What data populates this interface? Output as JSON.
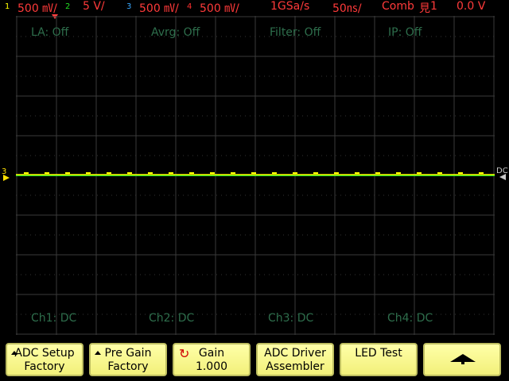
{
  "status": {
    "ch1": {
      "num": "1",
      "scale": "500 ㎷/"
    },
    "ch2": {
      "num": "2",
      "scale": "5 V/"
    },
    "ch3": {
      "num": "3",
      "scale": "500 ㎷/"
    },
    "ch4": {
      "num": "4",
      "scale": "500 ㎷/"
    },
    "sample_rate": "1GSa/s",
    "timebase": "50㎱/",
    "trigger_mode": "Comb",
    "trigger_icon": "rising-edge-icon",
    "trigger_source": "1",
    "trigger_level": "0.0 V"
  },
  "overlay": {
    "la": "LA: Off",
    "avrg": "Avrg: Off",
    "filter": "Filter: Off",
    "ip": "IP: Off",
    "ch1_coupling": "Ch1: DC",
    "ch2_coupling": "Ch2: DC",
    "ch3_coupling": "Ch3: DC",
    "ch4_coupling": "Ch4: DC"
  },
  "markers": {
    "channel_ground": "3",
    "dc_label": "DC"
  },
  "colors": {
    "ch1": "#ffff00",
    "ch2": "#22dd22",
    "ch3": "#3aa8ff",
    "ch4": "#ff3030",
    "grid": "#3a3a3a",
    "softkey": "#f5f38a"
  },
  "softkeys": [
    {
      "line1": "ADC Setup",
      "line2": "Factory",
      "icon": "triangle-up-icon"
    },
    {
      "line1": "Pre Gain",
      "line2": "Factory",
      "icon": "triangle-up-icon"
    },
    {
      "line1": "Gain",
      "line2": "1.000",
      "icon": "rotate-knob-icon"
    },
    {
      "line1": "ADC Driver",
      "line2": "Assembler"
    },
    {
      "line1": "LED Test",
      "line2": ""
    },
    {
      "line1": "",
      "line2": "",
      "icon": "up-arrow-icon"
    }
  ]
}
